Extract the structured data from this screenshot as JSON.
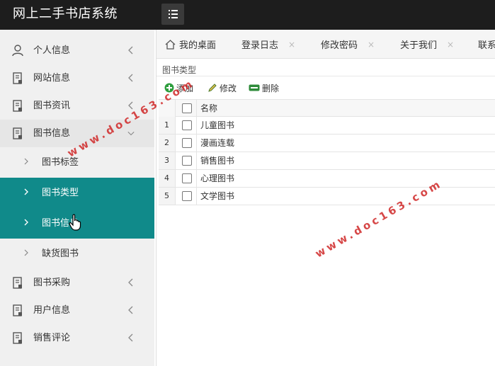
{
  "header": {
    "app_title": "网上二手书店系统"
  },
  "sidebar": {
    "items": [
      {
        "label": "个人信息",
        "icon": "person-icon"
      },
      {
        "label": "网站信息",
        "icon": "document-icon"
      },
      {
        "label": "图书资讯",
        "icon": "document-icon"
      },
      {
        "label": "图书信息",
        "icon": "document-icon",
        "expanded": true,
        "children": [
          {
            "label": "图书标签"
          },
          {
            "label": "图书类型",
            "active": true
          },
          {
            "label": "图书信息",
            "active": true
          },
          {
            "label": "缺货图书"
          }
        ]
      },
      {
        "label": "图书采购",
        "icon": "document-icon"
      },
      {
        "label": "用户信息",
        "icon": "document-icon"
      },
      {
        "label": "销售评论",
        "icon": "document-icon"
      }
    ]
  },
  "tabs": [
    {
      "label": "我的桌面",
      "icon": "home-icon"
    },
    {
      "label": "登录日志",
      "closable": true
    },
    {
      "label": "修改密码",
      "closable": true
    },
    {
      "label": "关于我们",
      "closable": true
    },
    {
      "label": "联系"
    }
  ],
  "tab_close_glyph": "×",
  "panel": {
    "title": "图书类型"
  },
  "toolbar": {
    "add_label": "添加",
    "edit_label": "修改",
    "delete_label": "删除"
  },
  "grid": {
    "column_name": "名称",
    "rows": [
      {
        "num": "1",
        "name": "儿童图书"
      },
      {
        "num": "2",
        "name": "漫画连载"
      },
      {
        "num": "3",
        "name": "销售图书"
      },
      {
        "num": "4",
        "name": "心理图书"
      },
      {
        "num": "5",
        "name": "文学图书"
      }
    ]
  },
  "watermark": {
    "text": "www.doc163.com"
  },
  "colors": {
    "topbar": "#1d1d1d",
    "active_nav": "#108a8a",
    "watermark": "#d02828",
    "add_icon": "#2e9e3e",
    "delete_icon": "#2e8b3a"
  }
}
